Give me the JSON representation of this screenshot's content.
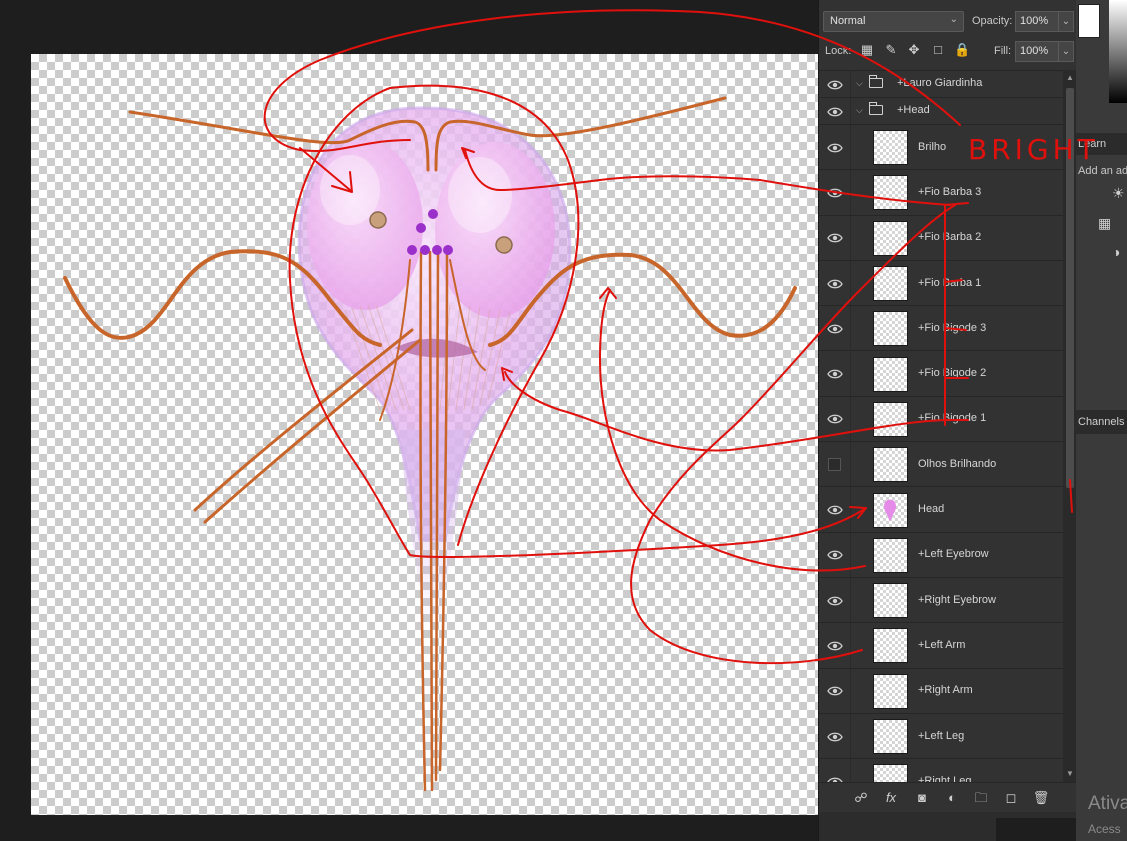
{
  "layers_panel": {
    "blend_mode": "Normal",
    "opacity_label": "Opacity:",
    "opacity_value": "100%",
    "lock_label": "Lock:",
    "fill_label": "Fill:",
    "fill_value": "100%",
    "layers": [
      {
        "name": "+Lauro Giardinha",
        "kind": "group",
        "visible": true
      },
      {
        "name": "+Head",
        "kind": "group",
        "visible": true
      },
      {
        "name": "Brilho",
        "kind": "layer",
        "visible": true
      },
      {
        "name": "+Fio Barba 3",
        "kind": "layer",
        "visible": true
      },
      {
        "name": "+Fio Barba 2",
        "kind": "layer",
        "visible": true
      },
      {
        "name": "+Fio Barba 1",
        "kind": "layer",
        "visible": true
      },
      {
        "name": "+Fio Bigode 3",
        "kind": "layer",
        "visible": true
      },
      {
        "name": "+Fio Bigode 2",
        "kind": "layer",
        "visible": true
      },
      {
        "name": "+Fio Bigode 1",
        "kind": "layer",
        "visible": true
      },
      {
        "name": "Olhos Brilhando",
        "kind": "layer",
        "visible": false
      },
      {
        "name": "Head",
        "kind": "layer",
        "visible": true
      },
      {
        "name": "+Left Eyebrow",
        "kind": "layer",
        "visible": true
      },
      {
        "name": "+Right Eyebrow",
        "kind": "layer",
        "visible": true
      },
      {
        "name": "+Left Arm",
        "kind": "layer",
        "visible": true
      },
      {
        "name": "+Right Arm",
        "kind": "layer",
        "visible": true
      },
      {
        "name": "+Left Leg",
        "kind": "layer",
        "visible": true
      },
      {
        "name": "+Right Leg",
        "kind": "layer",
        "visible": true
      }
    ]
  },
  "right_panels": {
    "learn_tab": "Learn",
    "adjust_text": "Add an adj",
    "channels_tab": "Channels"
  },
  "annotation": {
    "handwritten_label": "BRIGHT",
    "stroke_color": "#e0100c"
  },
  "watermark": {
    "line1": "Ativa",
    "line2": "Acess"
  },
  "colors": {
    "canvas_bg": "#1e1e1e",
    "panel_bg": "#323232",
    "row_divider": "#262626",
    "head_fill": "#e9b8f0",
    "whisker": "#c8652a",
    "bead": "#9b2fc9"
  }
}
